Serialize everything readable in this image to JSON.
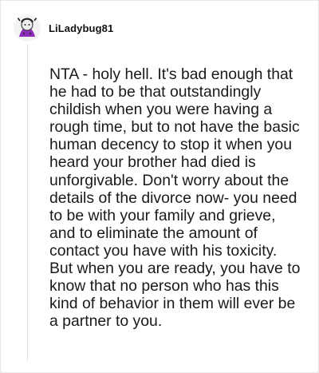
{
  "comment": {
    "author": {
      "username": "LiLadybug81",
      "avatar_icon": "ladybug-avatar-icon"
    },
    "body": "NTA - holy hell. It's bad enough that he had to be that outstandingly childish when you were having a rough time, but to not have the basic human decency to stop it when you heard your brother had died is unforgivable. Don't worry about the details of the divorce now- you need to be with your family and grieve, and to eliminate the amount of contact you have with his toxicity. But when you are ready, you have to know that no person who has this kind of behavior in them will ever be a partner to you."
  },
  "colors": {
    "text": "#1a1a1a",
    "border": "#e8e8e8",
    "thread_line": "#e2e2e2",
    "avatar_accent": "#8e2bbf"
  }
}
